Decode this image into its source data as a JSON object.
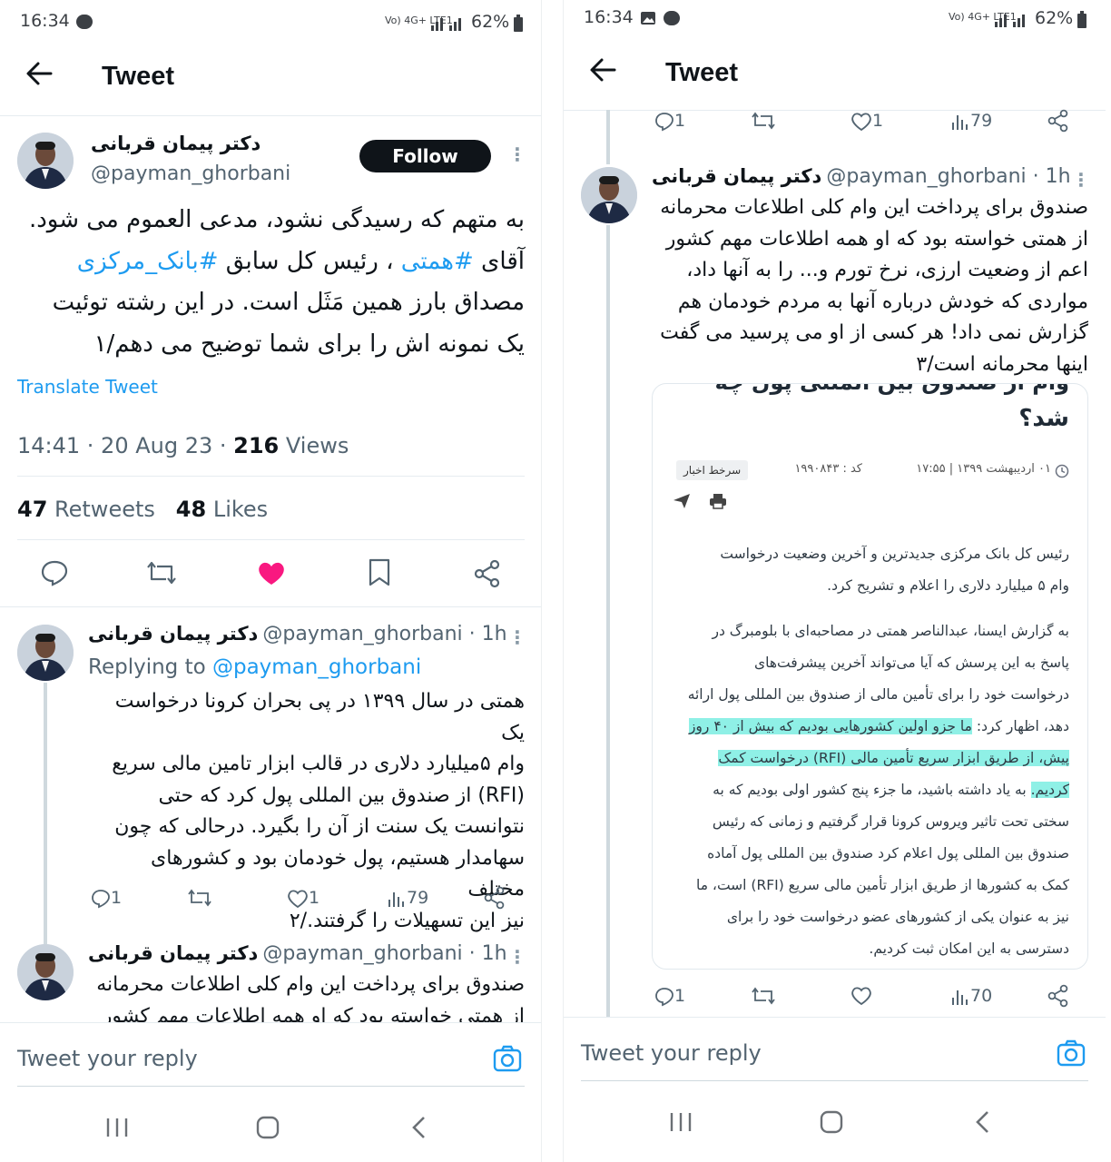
{
  "left": {
    "status": {
      "time": "16:34",
      "battery": "62%",
      "network": "Vo) 4G+ LTE1"
    },
    "header": {
      "title": "Tweet"
    },
    "tweet": {
      "author": "دکتر پیمان قربانی",
      "handle": "@payman_ghorbani",
      "follow_label": "Follow",
      "lines": [
        "به متهم که رسیدگی نشود، مدعی العموم می شود.",
        "آقای ",
        "#همتی",
        " ، رئیس کل سابق ",
        "#بانک_مرکزی",
        "مصداق بارز همین مَثَل است. در این رشته توئیت",
        "یک نمونه اش را برای شما توضیح می دهم/۱"
      ],
      "translate": "Translate Tweet",
      "meta_time": "14:41 · 20 Aug 23 · ",
      "views_count": "216",
      "views_label": " Views",
      "retweets_count": "47",
      "retweets_label": " Retweets",
      "likes_count": "48",
      "likes_label": " Likes"
    },
    "reply1": {
      "author": "دکتر پیمان قربانی",
      "handle": "@payman_ghorbani · 1h",
      "replying_prefix": "Replying to ",
      "replying_handle": "@payman_ghorbani",
      "lines": [
        "همتی در سال ۱۳۹۹ در پی بحران کرونا درخواست یک",
        "وام ۵میلیارد دلاری در قالب ابزار تامین مالی سریع",
        "(RFI) از صندوق بین المللی پول کرد که حتی",
        "نتوانست یک سنت از آن را بگیرد. درحالی که چون",
        "سهامدار هستیم، پول خودمان بود و کشورهای مختلف",
        "نیز این تسهیلات را گرفتند./۲"
      ],
      "replies": "1",
      "likes": "1",
      "views": "79"
    },
    "reply2": {
      "author": "دکتر پیمان قربانی",
      "handle": "@payman_ghorbani · 1h",
      "lines": [
        "صندوق برای پرداخت این وام کلی اطلاعات محرمانه",
        "از همتی خواسته بود که او همه اطلاعات مهم کشور"
      ]
    },
    "reply_bar": {
      "placeholder": "Tweet your reply"
    }
  },
  "right": {
    "status": {
      "time": "16:34",
      "battery": "62%",
      "network": "Vo) 4G+ LTE1"
    },
    "header": {
      "title": "Tweet"
    },
    "top_actions": {
      "replies": "1",
      "likes": "1",
      "views": "79"
    },
    "tweet": {
      "author": "دکتر پیمان قربانی",
      "handle": "@payman_ghorbani · 1h",
      "lines": [
        "صندوق برای پرداخت این وام کلی اطلاعات محرمانه",
        "از همتی خواسته بود که او همه اطلاعات مهم کشور",
        "اعم از وضعیت ارزی، نرخ تورم و... را به آنها داد،",
        "مواردی که خودش درباره آنها به مردم خودمان هم",
        "گزارش نمی داد! هر کسی از او می پرسید می گفت",
        "اینها محرمانه است/۳"
      ]
    },
    "article": {
      "headline_top": "وام از صندوق بین المللی پول چه",
      "headline": "شد؟",
      "date_line": "۰۱ اردیبهشت ۱۳۹۹ | ۱۷:۵۵",
      "code_line": "کد : ۱۹۹۰۸۴۳",
      "tag": "سرخط اخبار",
      "lead": [
        "رئیس کل بانک مرکزی جدیدترین و آخرین وضعیت درخواست",
        "وام ۵ میلیارد دلاری را اعلام و تشریح کرد."
      ],
      "para": [
        "به گزارش ایسنا، عبدالناصر همتی در مصاحبه‌ای با بلومبرگ در",
        "پاسخ به این پرسش که آیا می‌تواند آخرین پیشرفت‌های",
        "درخواست خود را برای تأمین مالی از صندوق بین المللی پول ارائه"
      ],
      "hl1_pre": "دهد، اظهار کرد: ",
      "hl1": "ما جزو اولین کشورهایی بودیم که بیش از ۴۰ روز",
      "hl2": "پیش، از طریق ابزار سریع تأمین مالی (RFI) درخواست کمک",
      "hl3": "کردیم.",
      "hl3_post": " به یاد داشته باشید، ما جزء پنج کشور اولی بودیم که به",
      "rest": [
        "سختی تحت تاثیر ویروس کرونا قرار گرفتیم و زمانی که رئیس",
        "صندوق بین المللی پول اعلام کرد صندوق بین المللی پول آماده",
        "کمک به کشورها از طریق ابزار تأمین مالی سریع (RFI) است، ما",
        "نیز به عنوان یکی از کشورهای عضو درخواست خود را برای",
        "دسترسی به این امکان ثبت کردیم."
      ]
    },
    "bottom_actions": {
      "replies": "1",
      "views": "70"
    },
    "reply_bar": {
      "placeholder": "Tweet your reply"
    }
  },
  "colors": {
    "accent": "#1d9bf0",
    "like": "#f91880",
    "highlight": "#8ff0e6"
  }
}
